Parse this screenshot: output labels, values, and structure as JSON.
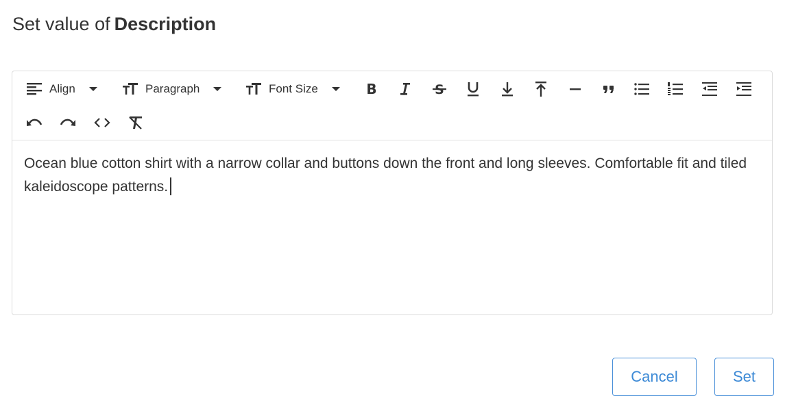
{
  "dialog": {
    "title_prefix": "Set value of",
    "field_name": "Description"
  },
  "toolbar": {
    "row1": [
      {
        "name": "align-dropdown",
        "icon": "align-left-icon",
        "label": "Align",
        "type": "dropdown"
      },
      {
        "name": "paragraph-dropdown",
        "icon": "text-size-icon",
        "label": "Paragraph",
        "type": "dropdown"
      },
      {
        "name": "font-size-dropdown",
        "icon": "text-size-icon",
        "label": "Font Size",
        "type": "dropdown"
      },
      {
        "name": "bold-button",
        "icon": "bold-icon"
      },
      {
        "name": "italic-button",
        "icon": "italic-icon"
      },
      {
        "name": "strikethrough-button",
        "icon": "strikethrough-icon"
      },
      {
        "name": "underline-button",
        "icon": "underline-icon"
      },
      {
        "name": "subscript-button",
        "icon": "arrow-down-to-line-icon"
      },
      {
        "name": "superscript-button",
        "icon": "arrow-up-from-line-icon"
      },
      {
        "name": "horizontal-rule-button",
        "icon": "horizontal-rule-icon"
      },
      {
        "name": "blockquote-button",
        "icon": "quote-icon"
      },
      {
        "name": "bullet-list-button",
        "icon": "bullet-list-icon"
      },
      {
        "name": "numbered-list-button",
        "icon": "numbered-list-icon"
      },
      {
        "name": "outdent-button",
        "icon": "outdent-icon"
      },
      {
        "name": "indent-button",
        "icon": "indent-icon"
      }
    ],
    "row2": [
      {
        "name": "undo-button",
        "icon": "undo-icon"
      },
      {
        "name": "redo-button",
        "icon": "redo-icon"
      },
      {
        "name": "code-view-button",
        "icon": "code-icon"
      },
      {
        "name": "clear-format-button",
        "icon": "clear-format-icon"
      }
    ]
  },
  "editor": {
    "content": "Ocean blue cotton shirt with a narrow collar and buttons down the front and long sleeves. Comfortable fit and tiled kaleidoscope patterns."
  },
  "buttons": {
    "cancel_label": "Cancel",
    "set_label": "Set"
  },
  "colors": {
    "accent": "#3d8ad6",
    "text": "#333333",
    "border": "#dcdcdc"
  }
}
